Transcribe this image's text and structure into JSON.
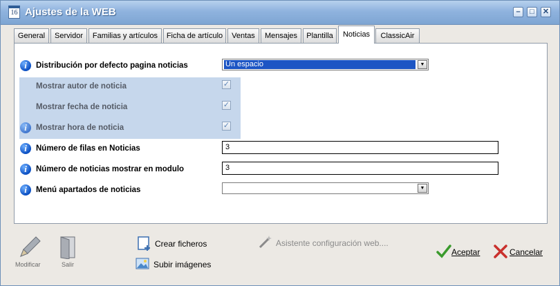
{
  "window": {
    "title": "Ajustes de la WEB",
    "icon_text": "16"
  },
  "tabs": [
    {
      "label": "General"
    },
    {
      "label": "Servidor"
    },
    {
      "label": "Familias y artículos"
    },
    {
      "label": "Ficha de artículo"
    },
    {
      "label": "Ventas"
    },
    {
      "label": "Mensajes"
    },
    {
      "label": "Plantilla"
    },
    {
      "label": "Noticias"
    },
    {
      "label": "ClassicAir"
    }
  ],
  "active_tab": "Noticias",
  "fields": {
    "distribucion": {
      "label": "Distribución por defecto pagina noticias",
      "value": "Un espacio"
    },
    "mostrar_autor": {
      "label": "Mostrar autor de noticia",
      "checked": true
    },
    "mostrar_fecha": {
      "label": "Mostrar fecha de noticia",
      "checked": true
    },
    "mostrar_hora": {
      "label": "Mostrar hora de noticia",
      "checked": true
    },
    "filas": {
      "label": "Número de filas en Noticias",
      "value": "3"
    },
    "noticias_modulo": {
      "label": "Número de noticias mostrar en modulo",
      "value": "3"
    },
    "menu_apartados": {
      "label": "Menú apartados de noticias",
      "value": ""
    }
  },
  "toolbar": {
    "modificar": "Modificar",
    "salir": "Salir",
    "crear_ficheros": "Crear ficheros",
    "subir_imagenes": "Subir imágenes",
    "asistente": "Asistente configuración web....",
    "aceptar": "Aceptar",
    "cancelar": "Cancelar"
  },
  "colors": {
    "accent": "#1c55c4",
    "title_bar": "#8fb3de",
    "highlight": "#c6d7ec",
    "info_icon": "#0b4fc2"
  }
}
